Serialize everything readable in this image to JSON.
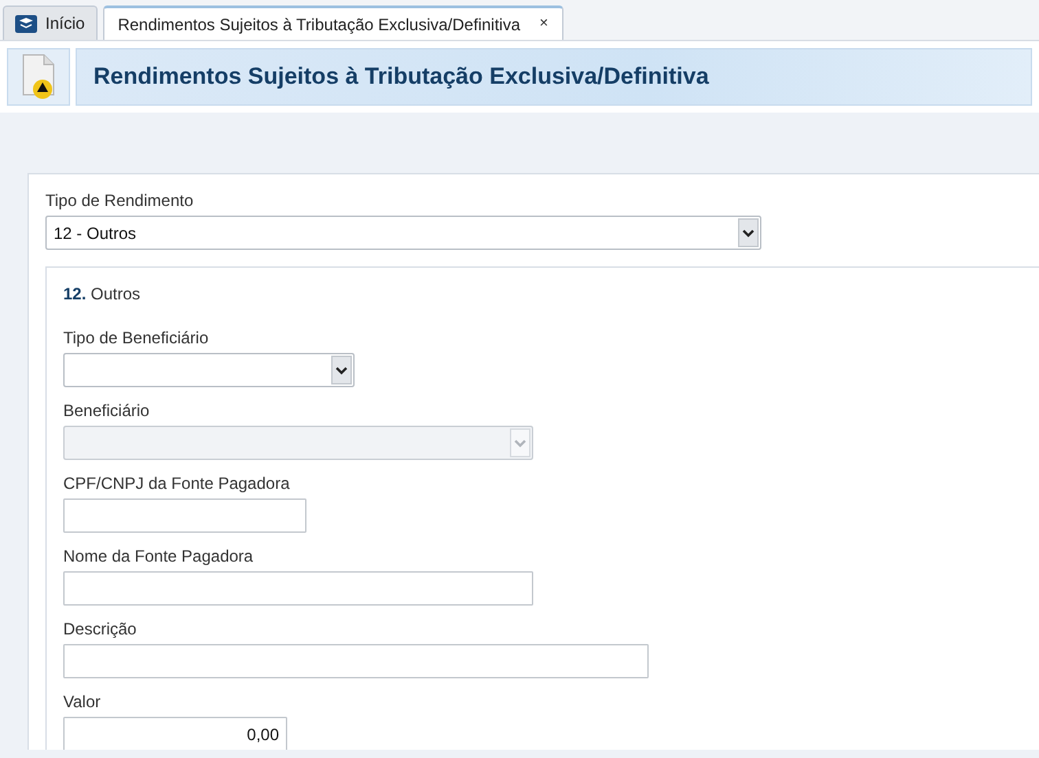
{
  "tabs": [
    {
      "label": "Início",
      "selected": false,
      "closable": false
    },
    {
      "label": "Rendimentos Sujeitos à Tributação Exclusiva/Definitiva",
      "selected": true,
      "closable": true
    }
  ],
  "close_glyph": "×",
  "header": {
    "title": "Rendimentos Sujeitos à Tributação Exclusiva/Definitiva"
  },
  "form": {
    "label": "Tipo de Rendimento",
    "value": "12 - Outros"
  },
  "section": {
    "heading": "**12.** Outros",
    "fields": [
      {
        "kind": "select",
        "label": "Tipo de Beneficiário",
        "disabled": false
      },
      {
        "kind": "select",
        "label": "Beneficiário",
        "disabled": true
      },
      {
        "kind": "text",
        "label": "CPF/CNPJ da Fonte Pagadora",
        "disabled": false
      },
      {
        "kind": "text",
        "label": "Nome da Fonte Pagadora",
        "disabled": false
      },
      {
        "kind": "text",
        "label": "Descrição",
        "disabled": false
      },
      {
        "kind": "number",
        "label": "Valor",
        "value": "0,00",
        "disabled": false
      }
    ]
  }
}
